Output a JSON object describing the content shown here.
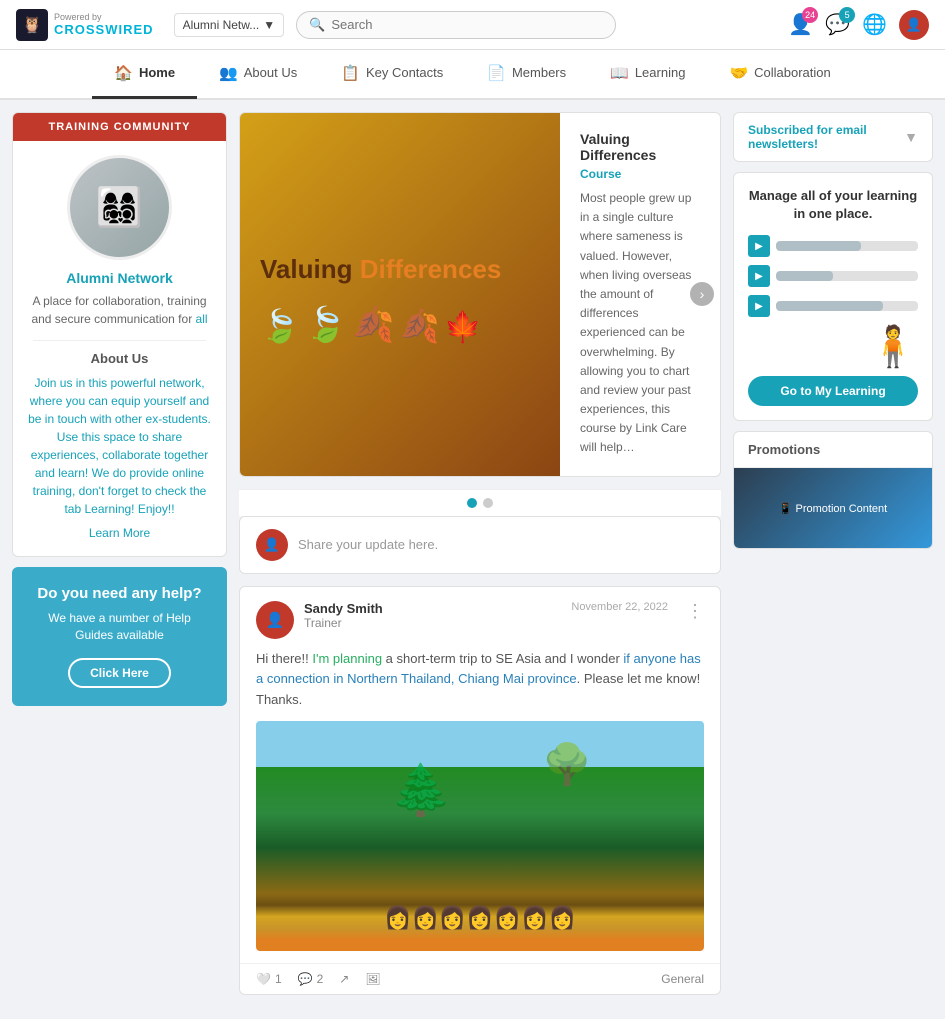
{
  "brand": {
    "powered_by": "Powered by",
    "name": "CROSSWIRED",
    "owl_emoji": "🦉"
  },
  "site_selector": {
    "label": "Alumni Netw...",
    "chevron": "▼"
  },
  "search": {
    "placeholder": "Search"
  },
  "topbar_icons": {
    "notifications_count": "24",
    "messages_count": "5"
  },
  "navbar": {
    "items": [
      {
        "id": "home",
        "label": "Home",
        "icon": "🏠",
        "active": true
      },
      {
        "id": "about",
        "label": "About Us",
        "icon": "👥"
      },
      {
        "id": "keycontacts",
        "label": "Key Contacts",
        "icon": "📋"
      },
      {
        "id": "members",
        "label": "Members",
        "icon": "📄"
      },
      {
        "id": "learning",
        "label": "Learning",
        "icon": "📖"
      },
      {
        "id": "collaboration",
        "label": "Collaboration",
        "icon": "🤝"
      }
    ]
  },
  "sidebar": {
    "header": "TRAINING COMMUNITY",
    "group_name": "Alumni Network",
    "description": "A place for collaboration, training and secure communication for",
    "description_link": "all",
    "about_label": "About Us",
    "about_text": "Join us in this powerful network, where you can equip yourself and be in touch with other ex-students. Use this space to share experiences, collaborate together and learn! We do provide online training, don't forget to check the tab Learning! Enjoy!!",
    "learn_more": "Learn More",
    "help": {
      "title": "Do you need any help?",
      "subtitle": "We have a number of Help Guides available",
      "button": "Click Here"
    }
  },
  "carousel": {
    "title": "Valuing Differences",
    "course_tag": "Course",
    "description": "Most people grew up in a single culture where sameness is valued. However, when living overseas the amount of differences experienced can be overwhelming. By allowing you to chart and review your past experiences, this course by Link Care will help…",
    "valuing_text": "Valuing",
    "differences_text": "Differences"
  },
  "post_input": {
    "placeholder": "Share your update here."
  },
  "feed_post": {
    "author": "Sandy Smith",
    "role": "Trainer",
    "date": "November 22, 2022",
    "text_parts": [
      {
        "type": "normal",
        "text": "Hi there!! "
      },
      {
        "type": "green",
        "text": "I'm planning"
      },
      {
        "type": "normal",
        "text": " a short-term trip to SE Asia and I wonder "
      },
      {
        "type": "blue",
        "text": "if anyone has a connection in Northern Thailand, Chiang Mai province"
      },
      {
        "type": "normal",
        "text": ". Please let me know! Thanks."
      }
    ],
    "likes": "1",
    "comments": "2",
    "category": "General"
  },
  "right_sidebar": {
    "newsletter": {
      "text_subscribed": "Subscribed for email newsletters!"
    },
    "learning": {
      "title": "Manage all of your learning in one place.",
      "button": "Go to My Learning",
      "bars": [
        60,
        40,
        75
      ]
    },
    "promotions": {
      "title": "Promotions"
    }
  }
}
